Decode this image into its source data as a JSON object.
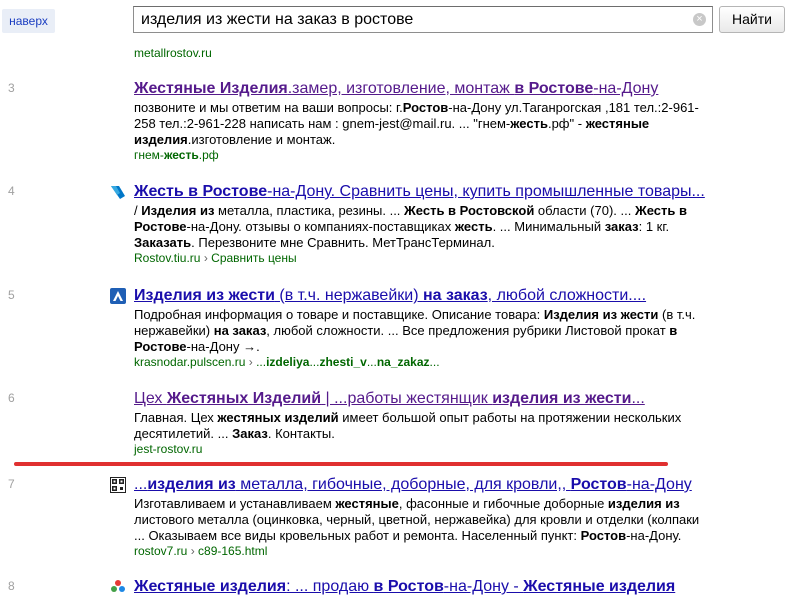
{
  "header": {
    "up_label": "наверх",
    "search_value": "изделия из жести на заказ в ростове",
    "find_label": "Найти"
  },
  "fragment_url": "metallrostov.ru",
  "results": [
    {
      "num": "3",
      "title_html": "<b>Жестяные Изделия</b>.замер, изготовление, монтаж <b>в Ростове</b>-на-Дону",
      "snippet_html": "позвоните и мы ответим на ваши вопросы: г.<b>Ростов</b>-на-Дону ул.Таганрогская ,181 тел.:2-961-258 тел.:2-961-228 написать нам : gnem-jest@mail.ru. ... \"гнем-<b>жесть</b>.рф\" - <b>жестяные изделия</b>.изготовление и монтаж.",
      "url_html": "гнем-<b>жесть</b>.рф"
    },
    {
      "num": "4",
      "title_html": "<b>Жесть в Ростове</b>-на-Дону. Сравнить цены, купить промышленные товары...",
      "snippet_html": "/ <b>Изделия из</b> металла, пластика, резины. ... <b>Жесть в Ростовской</b> области (70). ... <b>Жесть в Ростове</b>-на-Дону. отзывы о компаниях-поставщиках <b>жесть</b>. ... Минимальный <b>заказ</b>: 1 кг. <b>Заказать</b>. Перезвоните мне Сравнить. МетТрансТерминал.",
      "url_html": "Rostov.tiu.ru <span class=\"gray\">›</span> Сравнить цены"
    },
    {
      "num": "5",
      "title_html": "<b>Изделия из жести</b> (в т.ч. нержавейки) <b>на заказ</b>, любой сложности....",
      "snippet_html": "Подробная информация о товаре и поставщике. Описание товара: <b>Изделия из жести</b> (в т.ч. нержавейки) <b>на заказ</b>, любой сложности. ... Все предложения рубрики Листовой прокат <b>в Ростове</b>-на-Дону →.",
      "url_html": "krasnodar.pulscen.ru <span class=\"gray\">›</span> ...<b>izdeliya</b>...<b>zhesti_v</b>...<b>na_zakaz</b>..."
    },
    {
      "num": "6",
      "title_html": "Цех <b>Жестяных Изделий</b> | ...работы жестянщик <b>изделия из жести</b>...",
      "snippet_html": "Главная. Цех <b>жестяных изделий</b> имеет большой опыт работы на протяжении нескольких десятилетий. ... <b>Заказ</b>. Контакты.",
      "url_html": "jest-rostov.ru"
    },
    {
      "num": "7",
      "title_html": "...<b>изделия из</b> металла, гибочные, доборные, для кровли,, <b>Ростов</b>-на-Дону",
      "snippet_html": "Изготавливаем и устанавливаем <b>жестяные</b>, фасонные и гибочные доборные <b>изделия из</b> листового металла (оцинковка, черный, цветной, нержавейка) для кровли и отделки (колпаки ... Оказываем все виды кровельных работ и ремонта. Населенный пункт: <b>Ростов</b>-на-Дону.",
      "url_html": "rostov7.ru <span class=\"gray\">›</span> c89-165.html"
    },
    {
      "num": "8",
      "title_html": "<b>Жестяные изделия</b>: ... продаю <b>в Ростов</b>-на-Дону - <b>Жестяные изделия</b>",
      "snippet_html": "",
      "url_html": ""
    }
  ],
  "colors": {
    "link": "#1a0dab",
    "visited": "#551a8b",
    "url_green": "#006600",
    "annotation_line": "#e03030"
  }
}
